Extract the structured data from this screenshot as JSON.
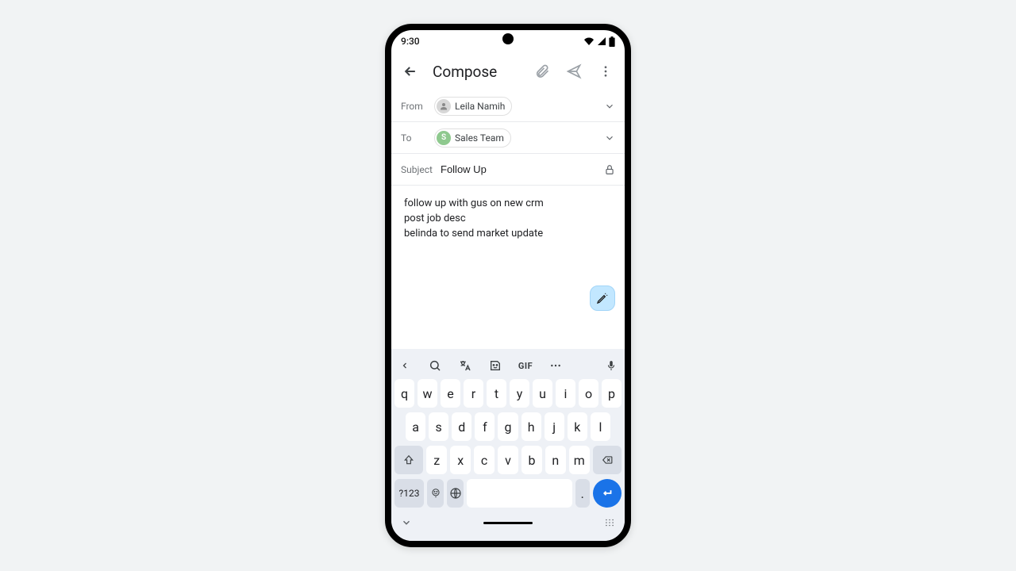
{
  "statusbar": {
    "time": "9:30"
  },
  "appbar": {
    "title": "Compose"
  },
  "from": {
    "label": "From",
    "name": "Leila Namih"
  },
  "to": {
    "label": "To",
    "initial": "S",
    "name": "Sales Team"
  },
  "subject": {
    "label": "Subject",
    "value": "Follow Up"
  },
  "body": {
    "line1": "follow up with gus on new crm",
    "line2": "post job desc",
    "line3": "belinda to send market update"
  },
  "keyboard": {
    "toolbar": {
      "gif": "GIF"
    },
    "row1": [
      "q",
      "w",
      "e",
      "r",
      "t",
      "y",
      "u",
      "i",
      "o",
      "p"
    ],
    "row2": [
      "a",
      "s",
      "d",
      "f",
      "g",
      "h",
      "j",
      "k",
      "l"
    ],
    "row3": [
      "z",
      "x",
      "c",
      "v",
      "b",
      "n",
      "m"
    ],
    "numSwitch": "?123",
    "period": "."
  }
}
